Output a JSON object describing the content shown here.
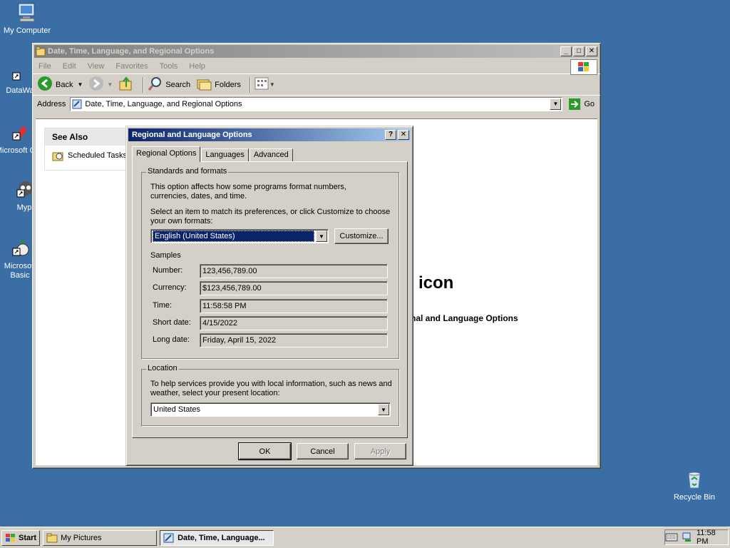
{
  "desktop": {
    "icons": [
      {
        "label": "My Computer"
      },
      {
        "label": "DataWa"
      },
      {
        "label": "Microsoft C++"
      },
      {
        "label": "Myp"
      },
      {
        "label": "Microsoft Basic"
      },
      {
        "label": "Recycle Bin"
      }
    ]
  },
  "explorer": {
    "title": "Date, Time, Language, and Regional Options",
    "menu": [
      "File",
      "Edit",
      "View",
      "Favorites",
      "Tools",
      "Help"
    ],
    "toolbar": {
      "back": "Back",
      "search": "Search",
      "folders": "Folders"
    },
    "address_label": "Address",
    "address_value": "Date, Time, Language, and Regional Options",
    "go_label": "Go",
    "see_also": {
      "title": "See Also",
      "item": "Scheduled Tasks"
    },
    "bg_text_large": "icon",
    "bg_text_small": "nal and Language Options"
  },
  "dialog": {
    "title": "Regional and Language Options",
    "help_btn": "?",
    "close_btn": "✕",
    "tabs": [
      "Regional Options",
      "Languages",
      "Advanced"
    ],
    "standards": {
      "legend": "Standards and formats",
      "desc": "This option affects how some programs format numbers, currencies, dates, and time.",
      "select_prompt": "Select an item to match its preferences, or click Customize to choose your own formats:",
      "selected_locale": "English (United States)",
      "customize_label": "Customize...",
      "samples_label": "Samples",
      "samples": [
        {
          "label": "Number:",
          "value": "123,456,789.00"
        },
        {
          "label": "Currency:",
          "value": "$123,456,789.00"
        },
        {
          "label": "Time:",
          "value": "11:58:58 PM"
        },
        {
          "label": "Short date:",
          "value": "4/15/2022"
        },
        {
          "label": "Long date:",
          "value": "Friday, April 15, 2022"
        }
      ]
    },
    "location": {
      "legend": "Location",
      "desc": "To help services provide you with local information, such as news and weather, select your present location:",
      "value": "United States"
    },
    "buttons": {
      "ok": "OK",
      "cancel": "Cancel",
      "apply": "Apply"
    }
  },
  "taskbar": {
    "start": "Start",
    "tasks": [
      "My Pictures",
      "Date, Time, Language..."
    ],
    "clock": "11:58 PM"
  }
}
